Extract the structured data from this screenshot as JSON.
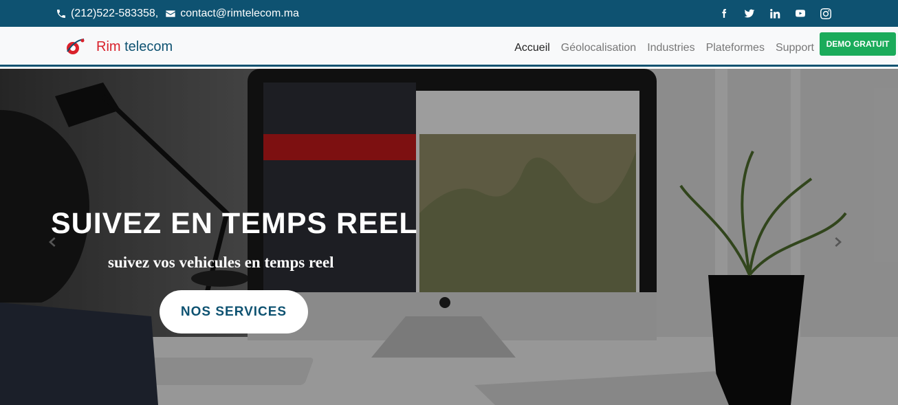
{
  "topbar": {
    "phone": "(212)522-583358,",
    "email": "contact@rimtelecom.ma",
    "social": [
      "facebook-icon",
      "twitter-icon",
      "linkedin-icon",
      "youtube-icon",
      "instagram-icon"
    ]
  },
  "brand": {
    "name_part1": "Rim",
    "name_part2": "telecom"
  },
  "nav": {
    "items": [
      "Accueil",
      "Géolocalisation",
      "Industries",
      "Plateformes",
      "Support"
    ],
    "active": "Accueil",
    "demo_label": "DEMO GRATUIT"
  },
  "hero": {
    "title": "SUIVEZ EN TEMPS REEL",
    "subtitle": "suivez vos vehicules en temps reel",
    "button": "NOS SERVICES"
  },
  "colors": {
    "primary": "#0e5271",
    "accent_red": "#d9212b",
    "demo_green": "#1aab5a"
  }
}
